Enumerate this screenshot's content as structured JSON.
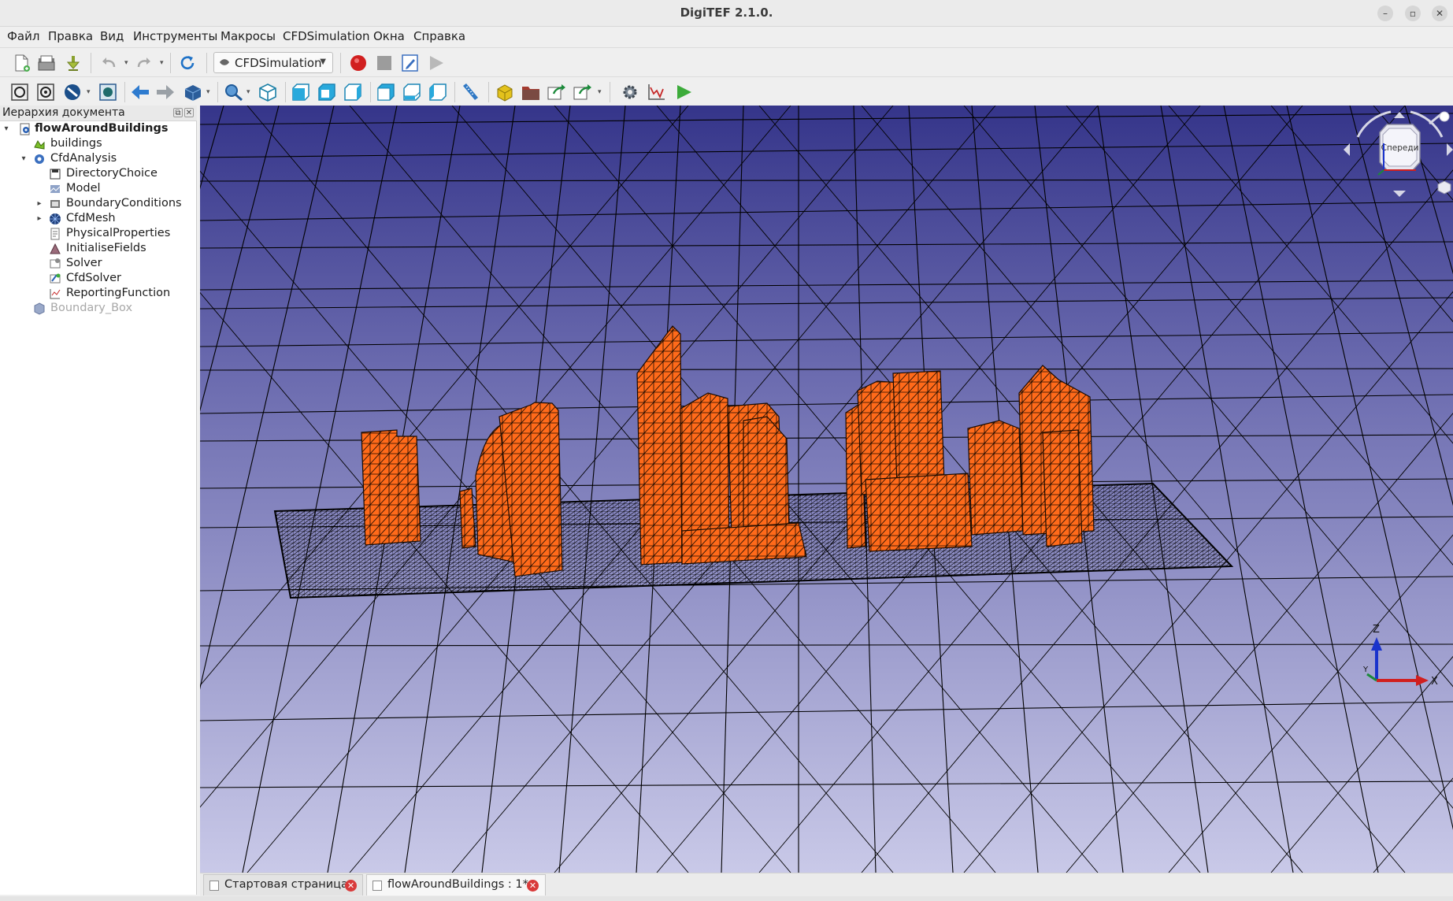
{
  "window": {
    "title": "DigiTEF 2.1.0.",
    "controls": {
      "minimize": "–",
      "restore": "▫",
      "close": "✕"
    }
  },
  "menu": [
    "Файл",
    "Правка",
    "Вид",
    "Инструменты",
    "Макросы",
    "CFDSimulation",
    "Окна",
    "Справка"
  ],
  "toolbar": {
    "workbench_selected": "CFDSimulation"
  },
  "tree": {
    "header": "Иерархия документа",
    "items": [
      {
        "label": "flowAroundBuildings",
        "icon": "document-icon"
      },
      {
        "label": "buildings",
        "icon": "mesh-shape-icon"
      },
      {
        "label": "CfdAnalysis",
        "icon": "analysis-icon"
      },
      {
        "label": "DirectoryChoice",
        "icon": "folder-icon"
      },
      {
        "label": "Model",
        "icon": "model-icon"
      },
      {
        "label": "BoundaryConditions",
        "icon": "boundary-icon"
      },
      {
        "label": "CfdMesh",
        "icon": "mesh-icon"
      },
      {
        "label": "PhysicalProperties",
        "icon": "properties-icon"
      },
      {
        "label": "InitialiseFields",
        "icon": "fields-icon"
      },
      {
        "label": "Solver",
        "icon": "solver-icon"
      },
      {
        "label": "CfdSolver",
        "icon": "cfd-solver-icon"
      },
      {
        "label": "ReportingFunction",
        "icon": "chart-icon"
      },
      {
        "label": "Boundary_Box",
        "icon": "box-icon"
      }
    ]
  },
  "navcube": {
    "face_label": "Спереди"
  },
  "axes": {
    "x": "X",
    "y": "Y",
    "z": "Z"
  },
  "tabs": [
    {
      "label": "Стартовая страница",
      "active": false
    },
    {
      "label": "flowAroundBuildings : 1*",
      "active": true
    }
  ],
  "colors": {
    "building": "#ff6a1a",
    "mesh": "#000000",
    "background_top": "#35358a",
    "background_bottom": "#c9c9e8",
    "close_badge": "#d93a3a"
  }
}
